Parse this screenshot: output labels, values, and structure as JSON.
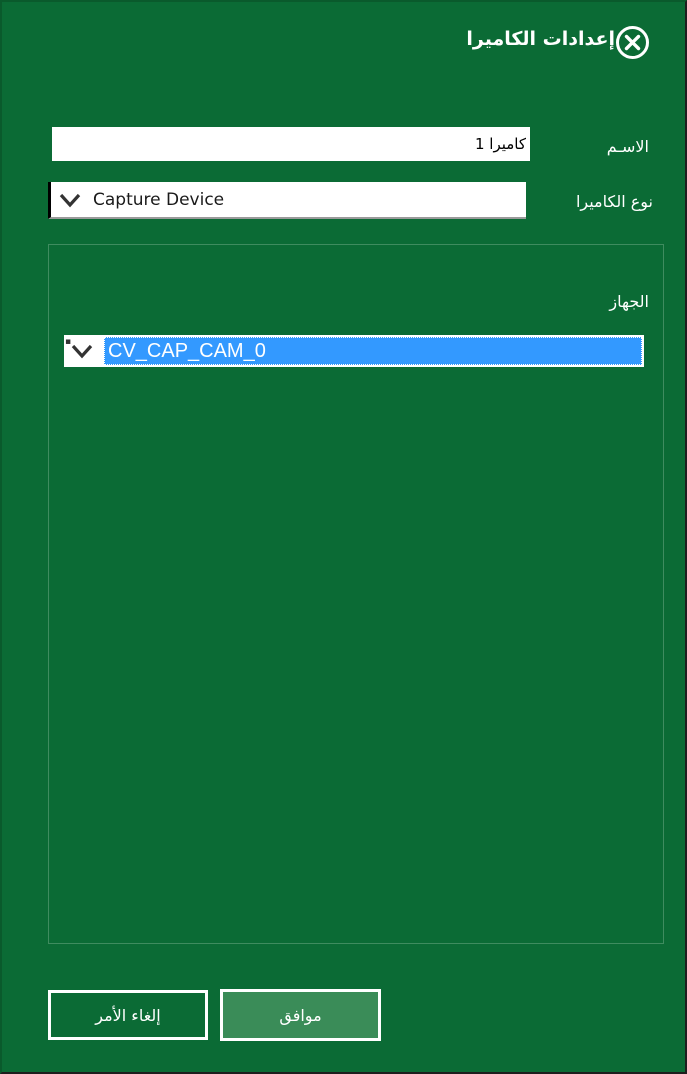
{
  "dialog": {
    "title": "إعدادات الكاميرا"
  },
  "icons": {
    "close": "close-icon",
    "dropdown": "chevron-down-icon"
  },
  "colors": {
    "background": "#0b6b35",
    "selection": "#3399ff",
    "ok_button": "#3a8c58",
    "text": "#ffffff"
  },
  "form": {
    "name_label": "الاسـم",
    "name_value": "كاميرا 1",
    "camera_type_label": "نوع الكاميرا",
    "camera_type_value": "Capture Device",
    "device_label": "الجهاز",
    "device_value": "CV_CAP_CAM_0"
  },
  "buttons": {
    "ok": "موافق",
    "cancel": "إلغاء الأمر"
  }
}
